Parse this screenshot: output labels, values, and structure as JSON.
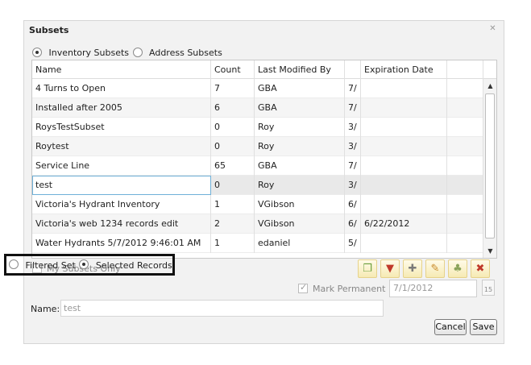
{
  "dialog": {
    "title": "Subsets",
    "close_icon": "close-icon"
  },
  "subset_type": {
    "inventory_label": "Inventory Subsets",
    "address_label": "Address Subsets",
    "selected": "inventory"
  },
  "grid": {
    "columns": [
      "Name",
      "Count",
      "Last Modified By",
      "",
      "Expiration Date",
      ""
    ],
    "rows": [
      {
        "name": "4 Turns to Open",
        "count": "7",
        "modified_by": "GBA",
        "col4": "7/",
        "expiration": ""
      },
      {
        "name": "Installed after 2005",
        "count": "6",
        "modified_by": "GBA",
        "col4": "7/",
        "expiration": ""
      },
      {
        "name": "RoysTestSubset",
        "count": "0",
        "modified_by": "Roy",
        "col4": "3/",
        "expiration": ""
      },
      {
        "name": "Roytest",
        "count": "0",
        "modified_by": "Roy",
        "col4": "3/",
        "expiration": ""
      },
      {
        "name": "Service Line",
        "count": "65",
        "modified_by": "GBA",
        "col4": "7/",
        "expiration": ""
      },
      {
        "name": "test",
        "count": "0",
        "modified_by": "Roy",
        "col4": "3/",
        "expiration": ""
      },
      {
        "name": "Victoria's Hydrant Inventory",
        "count": "1",
        "modified_by": "VGibson",
        "col4": "6/",
        "expiration": ""
      },
      {
        "name": "Victoria's web 1234 records edit",
        "count": "2",
        "modified_by": "VGibson",
        "col4": "6/",
        "expiration": "6/22/2012"
      },
      {
        "name": "Water Hydrants 5/7/2012 9:46:01 AM",
        "count": "1",
        "modified_by": "edaniel",
        "col4": "5/",
        "expiration": ""
      }
    ],
    "selected_row": 5
  },
  "my_subsets_only": {
    "label": "My Subsets Only",
    "checked": false
  },
  "toolbar": {
    "icons": [
      "copy-icon",
      "filter-icon",
      "add-icon",
      "edit-icon",
      "share-icon",
      "delete-icon"
    ]
  },
  "filter_mode": {
    "filtered_label": "Filtered Set",
    "selected_label": "Selected Records",
    "selected": "selected"
  },
  "mark_permanent": {
    "label": "Mark Permanent",
    "checked": true
  },
  "expiration_input": {
    "value": "7/1/2012",
    "calendar_label": "15"
  },
  "name_field": {
    "label": "Name:",
    "value": "test"
  },
  "buttons": {
    "cancel": "Cancel",
    "save": "Save"
  },
  "colors": {
    "highlight_border": "#111111",
    "accent": "#6fb0d8"
  }
}
